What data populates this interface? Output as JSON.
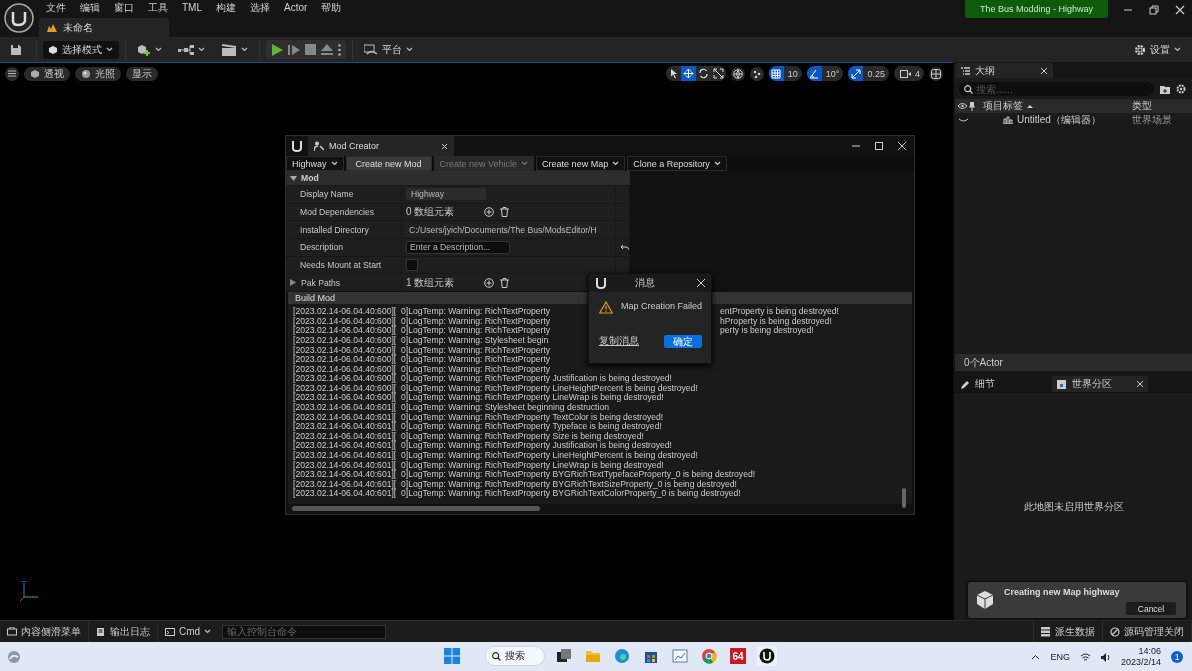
{
  "menu": [
    "文件",
    "编辑",
    "窗口",
    "工具",
    "TML",
    "构建",
    "选择",
    "Actor",
    "帮助"
  ],
  "level_tab": {
    "label": "未命名"
  },
  "project_badge": "The Bus Modding - Highway",
  "toolbar": {
    "mode": "选择模式",
    "platform": "平台",
    "settings": "设置"
  },
  "viewport": {
    "view_buttons": [
      "透视",
      "光照",
      "显示"
    ],
    "transform_tools": [
      {
        "selected": false
      },
      {
        "selected": true
      },
      {
        "selected": false
      },
      {
        "selected": false
      }
    ],
    "snaps": [
      {
        "kind": "grid",
        "value": "10",
        "on": true
      },
      {
        "kind": "angle",
        "value": "10°",
        "on": true
      },
      {
        "kind": "scale",
        "value": "0.25",
        "on": true
      }
    ],
    "camera_speed": "4"
  },
  "mod_creator": {
    "title": "Mod Creator",
    "toolbar": [
      {
        "label": "Highway",
        "dropdown": true,
        "disabled": false,
        "selected": false
      },
      {
        "label": "Create new Mod",
        "dropdown": false,
        "disabled": false,
        "selected": true
      },
      {
        "label": "Create new Vehicle",
        "dropdown": true,
        "disabled": true,
        "selected": false
      },
      {
        "label": "Create new Map",
        "dropdown": true,
        "disabled": false,
        "selected": false
      },
      {
        "label": "Clone a Repository",
        "dropdown": true,
        "disabled": false,
        "selected": false
      }
    ],
    "section": {
      "label": "Mod",
      "expanded": true
    },
    "properties": [
      {
        "label": "Display Name",
        "kind": "text",
        "value": "Highway"
      },
      {
        "label": "Mod Dependencies",
        "kind": "array",
        "value": "0 数组元素"
      },
      {
        "label": "Installed Directory",
        "kind": "path",
        "value": "C:/Users/jyich/Documents/The Bus/ModsEditor/H"
      },
      {
        "label": "Description",
        "kind": "input",
        "placeholder": "Enter a Description..."
      },
      {
        "label": "Needs Mount at Start",
        "kind": "checkbox",
        "checked": false
      },
      {
        "label": "Pak Paths",
        "kind": "array",
        "value": "1 数组元素",
        "expanded": false,
        "expandable": true
      }
    ],
    "build_title": "Build Mod",
    "log": [
      {
        "text": "[2023.02.14-06.04.40:600][  0]LogTemp: Warning: RichTextProperty",
        "tail": "entProperty is being destroyed!"
      },
      {
        "text": "[2023.02.14-06.04.40:600][  0]LogTemp: Warning: RichTextProperty",
        "tail": "hProperty is being destroyed!"
      },
      {
        "text": "[2023.02.14-06.04.40:600][  0]LogTemp: Warning: RichTextProperty",
        "tail": "perty is being destroyed!"
      },
      {
        "text": "[2023.02.14-06.04.40:600][  0]LogTemp: Warning: Stylesheet begin"
      },
      {
        "text": "[2023.02.14-06.04.40:600][  0]LogTemp: Warning: RichTextProperty"
      },
      {
        "text": "[2023.02.14-06.04.40:600][  0]LogTemp: Warning: RichTextProperty"
      },
      {
        "text": "[2023.02.14-06.04.40:600][  0]LogTemp: Warning: RichTextProperty"
      },
      {
        "text": "[2023.02.14-06.04.40:600][  0]LogTemp: Warning: RichTextProperty Justification is being destroyed!"
      },
      {
        "text": "[2023.02.14-06.04.40:600][  0]LogTemp: Warning: RichTextProperty LineHeightPercent is being destroyed!"
      },
      {
        "text": "[2023.02.14-06.04.40:600][  0]LogTemp: Warning: RichTextProperty LineWrap is being destroyed!"
      },
      {
        "text": "[2023.02.14-06.04.40:601][  0]LogTemp: Warning: Stylesheet beginning destruction"
      },
      {
        "text": "[2023.02.14-06.04.40:601][  0]LogTemp: Warning: RichTextProperty TextColor is being destroyed!"
      },
      {
        "text": "[2023.02.14-06.04.40:601][  0]LogTemp: Warning: RichTextProperty Typeface is being destroyed!"
      },
      {
        "text": "[2023.02.14-06.04.40:601][  0]LogTemp: Warning: RichTextProperty Size is being destroyed!"
      },
      {
        "text": "[2023.02.14-06.04.40:601][  0]LogTemp: Warning: RichTextProperty Justification is being destroyed!"
      },
      {
        "text": "[2023.02.14-06.04.40:601][  0]LogTemp: Warning: RichTextProperty LineHeightPercent is being destroyed!"
      },
      {
        "text": "[2023.02.14-06.04.40:601][  0]LogTemp: Warning: RichTextProperty LineWrap is being destroyed!"
      },
      {
        "text": "[2023.02.14-06.04.40:601][  0]LogTemp: Warning: RichTextProperty BYGRichTextTypefaceProperty_0 is being destroyed!"
      },
      {
        "text": "[2023.02.14-06.04.40:601][  0]LogTemp: Warning: RichTextProperty BYGRichTextSizeProperty_0 is being destroyed!"
      },
      {
        "text": "[2023.02.14-06.04.40:601][  0]LogTemp: Warning: RichTextProperty BYGRichTextColorProperty_0 is being destroyed!"
      }
    ]
  },
  "dialog": {
    "title": "消息",
    "message": "Map Creation Failed",
    "copy_link": "复制消息",
    "ok_button": "确定"
  },
  "outliner": {
    "tab": "大纲",
    "search_placeholder": "搜索......",
    "columns": [
      "项目标签",
      "类型"
    ],
    "rows": [
      {
        "label": "Untitled（编辑器）",
        "type": "世界场景",
        "visible": true
      }
    ],
    "footer": "0个Actor"
  },
  "details": {
    "tabs": [
      {
        "label": "细节",
        "selected": false
      },
      {
        "label": "世界分区",
        "selected": true
      }
    ],
    "message": "此地图未启用世界分区"
  },
  "status_bar": {
    "left": [
      "内容侧滑菜单",
      "输出日志"
    ],
    "cmd": "Cmd",
    "console_placeholder": "输入控制台命令",
    "right": [
      "派生数据",
      "源码管理关闭"
    ]
  },
  "notification": {
    "text": "Creating new Map highway",
    "button": "Cancel"
  },
  "taskbar": {
    "search": "搜索",
    "app_badge": "64",
    "language": "ENG",
    "time": "14:06",
    "date": "2023/2/14",
    "notifications": "1"
  }
}
